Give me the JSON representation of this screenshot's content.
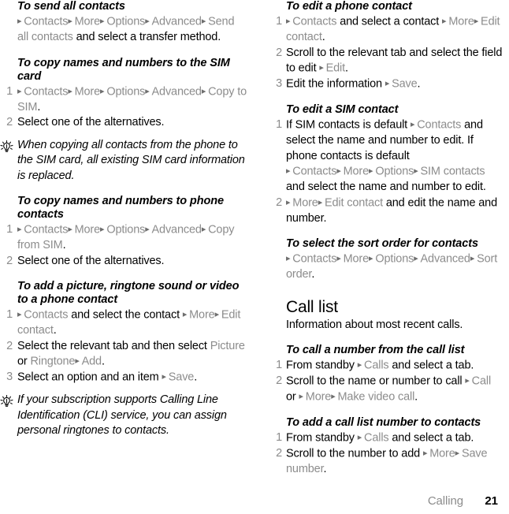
{
  "footer": {
    "chapter": "Calling",
    "page_number": "21"
  },
  "icons": {
    "tip": "lightbulb-icon",
    "arrow": "▸"
  },
  "left_column": [
    {
      "type": "procedure",
      "name": "send-all-contacts",
      "heading": "To send all contacts",
      "steps": [
        {
          "num": "",
          "parts": [
            {
              "t": "arrow"
            },
            {
              "t": "ui",
              "v": "Contacts"
            },
            {
              "t": "arrow"
            },
            {
              "t": "ui",
              "v": "More"
            },
            {
              "t": "arrow"
            },
            {
              "t": "ui",
              "v": "Options"
            },
            {
              "t": "arrow"
            },
            {
              "t": "ui",
              "v": "Advanced"
            },
            {
              "t": "arrow"
            },
            {
              "t": "ui",
              "v": "Send all contacts"
            },
            {
              "t": "txt",
              "v": " and select a transfer method."
            }
          ]
        }
      ]
    },
    {
      "type": "procedure",
      "name": "copy-names-numbers-to-sim",
      "heading": "To copy names and numbers to the SIM card",
      "steps": [
        {
          "num": "1",
          "parts": [
            {
              "t": "arrow"
            },
            {
              "t": "ui",
              "v": "Contacts"
            },
            {
              "t": "arrow"
            },
            {
              "t": "ui",
              "v": "More"
            },
            {
              "t": "arrow"
            },
            {
              "t": "ui",
              "v": "Options"
            },
            {
              "t": "arrow"
            },
            {
              "t": "ui",
              "v": "Advanced"
            },
            {
              "t": "arrow"
            },
            {
              "t": "ui",
              "v": "Copy to SIM"
            },
            {
              "t": "txt",
              "v": "."
            }
          ]
        },
        {
          "num": "2",
          "parts": [
            {
              "t": "txt",
              "v": "Select one of the alternatives."
            }
          ]
        }
      ]
    },
    {
      "type": "tip",
      "name": "tip-copy-replaces-sim",
      "text": "When copying all contacts from the phone to the SIM card, all existing SIM card information is replaced."
    },
    {
      "type": "procedure",
      "name": "copy-names-numbers-to-phone",
      "heading": "To copy names and numbers to phone contacts",
      "steps": [
        {
          "num": "1",
          "parts": [
            {
              "t": "arrow"
            },
            {
              "t": "ui",
              "v": "Contacts"
            },
            {
              "t": "arrow"
            },
            {
              "t": "ui",
              "v": "More"
            },
            {
              "t": "arrow"
            },
            {
              "t": "ui",
              "v": "Options"
            },
            {
              "t": "arrow"
            },
            {
              "t": "ui",
              "v": "Advanced"
            },
            {
              "t": "arrow"
            },
            {
              "t": "ui",
              "v": "Copy from SIM"
            },
            {
              "t": "txt",
              "v": "."
            }
          ]
        },
        {
          "num": "2",
          "parts": [
            {
              "t": "txt",
              "v": "Select one of the alternatives."
            }
          ]
        }
      ]
    },
    {
      "type": "procedure",
      "name": "add-picture-ringtone-video",
      "heading": "To add a picture, ringtone sound or video to a phone contact",
      "steps": [
        {
          "num": "1",
          "parts": [
            {
              "t": "arrow"
            },
            {
              "t": "ui",
              "v": "Contacts"
            },
            {
              "t": "txt",
              "v": " and select the contact "
            },
            {
              "t": "arrow"
            },
            {
              "t": "ui",
              "v": "More"
            },
            {
              "t": "arrow"
            },
            {
              "t": "ui",
              "v": "Edit contact"
            },
            {
              "t": "txt",
              "v": "."
            }
          ]
        },
        {
          "num": "2",
          "parts": [
            {
              "t": "txt",
              "v": "Select the relevant tab and then select "
            },
            {
              "t": "ui",
              "v": "Picture"
            },
            {
              "t": "txt",
              "v": " or "
            },
            {
              "t": "ui",
              "v": "Ringtone"
            },
            {
              "t": "arrow"
            },
            {
              "t": "ui",
              "v": "Add"
            },
            {
              "t": "txt",
              "v": "."
            }
          ]
        },
        {
          "num": "3",
          "parts": [
            {
              "t": "txt",
              "v": "Select an option and an item "
            },
            {
              "t": "arrow"
            },
            {
              "t": "ui",
              "v": "Save"
            },
            {
              "t": "txt",
              "v": "."
            }
          ]
        }
      ]
    },
    {
      "type": "tip",
      "name": "tip-cli-personal-ringtones",
      "text": "If your subscription supports Calling Line Identification (CLI) service, you can assign personal ringtones to contacts."
    }
  ],
  "right_column": [
    {
      "type": "procedure",
      "name": "edit-phone-contact",
      "heading": "To edit a phone contact",
      "steps": [
        {
          "num": "1",
          "parts": [
            {
              "t": "arrow"
            },
            {
              "t": "ui",
              "v": "Contacts"
            },
            {
              "t": "txt",
              "v": " and select a contact "
            },
            {
              "t": "arrow"
            },
            {
              "t": "ui",
              "v": "More"
            },
            {
              "t": "arrow"
            },
            {
              "t": "ui",
              "v": "Edit contact"
            },
            {
              "t": "txt",
              "v": "."
            }
          ]
        },
        {
          "num": "2",
          "parts": [
            {
              "t": "txt",
              "v": "Scroll to the relevant tab and select the field to edit "
            },
            {
              "t": "arrow"
            },
            {
              "t": "ui",
              "v": "Edit"
            },
            {
              "t": "txt",
              "v": "."
            }
          ]
        },
        {
          "num": "3",
          "parts": [
            {
              "t": "txt",
              "v": "Edit the information "
            },
            {
              "t": "arrow"
            },
            {
              "t": "ui",
              "v": "Save"
            },
            {
              "t": "txt",
              "v": "."
            }
          ]
        }
      ]
    },
    {
      "type": "procedure",
      "name": "edit-sim-contact",
      "heading": "To edit a SIM contact",
      "steps": [
        {
          "num": "1",
          "parts": [
            {
              "t": "txt",
              "v": "If SIM contacts is default "
            },
            {
              "t": "arrow"
            },
            {
              "t": "ui",
              "v": "Contacts"
            },
            {
              "t": "txt",
              "v": " and select the name and number to edit. If phone contacts is default "
            },
            {
              "t": "arrow"
            },
            {
              "t": "ui",
              "v": "Contacts"
            },
            {
              "t": "arrow"
            },
            {
              "t": "ui",
              "v": "More"
            },
            {
              "t": "arrow"
            },
            {
              "t": "ui",
              "v": "Options"
            },
            {
              "t": "arrow"
            },
            {
              "t": "ui",
              "v": "SIM contacts"
            },
            {
              "t": "txt",
              "v": " and select the name and number to edit."
            }
          ]
        },
        {
          "num": "2",
          "parts": [
            {
              "t": "arrow"
            },
            {
              "t": "ui",
              "v": "More"
            },
            {
              "t": "arrow"
            },
            {
              "t": "ui",
              "v": "Edit contact"
            },
            {
              "t": "txt",
              "v": " and edit the name and number."
            }
          ]
        }
      ]
    },
    {
      "type": "procedure",
      "name": "select-sort-order",
      "heading": "To select the sort order for contacts",
      "steps": [
        {
          "num": "",
          "parts": [
            {
              "t": "arrow"
            },
            {
              "t": "ui",
              "v": "Contacts"
            },
            {
              "t": "arrow"
            },
            {
              "t": "ui",
              "v": "More"
            },
            {
              "t": "arrow"
            },
            {
              "t": "ui",
              "v": "Options"
            },
            {
              "t": "arrow"
            },
            {
              "t": "ui",
              "v": "Advanced"
            },
            {
              "t": "arrow"
            },
            {
              "t": "ui",
              "v": "Sort order"
            },
            {
              "t": "txt",
              "v": "."
            }
          ]
        }
      ]
    },
    {
      "type": "section",
      "name": "call-list",
      "heading": "Call list",
      "body": "Information about most recent calls."
    },
    {
      "type": "procedure",
      "name": "call-number-from-call-list",
      "heading": "To call a number from the call list",
      "steps": [
        {
          "num": "1",
          "parts": [
            {
              "t": "txt",
              "v": "From standby "
            },
            {
              "t": "arrow"
            },
            {
              "t": "ui",
              "v": "Calls"
            },
            {
              "t": "txt",
              "v": " and select a tab."
            }
          ]
        },
        {
          "num": "2",
          "parts": [
            {
              "t": "txt",
              "v": "Scroll to the name or number to call "
            },
            {
              "t": "arrow"
            },
            {
              "t": "ui",
              "v": "Call"
            },
            {
              "t": "txt",
              "v": " or "
            },
            {
              "t": "arrow"
            },
            {
              "t": "ui",
              "v": "More"
            },
            {
              "t": "arrow"
            },
            {
              "t": "ui",
              "v": "Make video call"
            },
            {
              "t": "txt",
              "v": "."
            }
          ]
        }
      ]
    },
    {
      "type": "procedure",
      "name": "add-call-list-number-to-contacts",
      "heading": "To add a call list number to contacts",
      "steps": [
        {
          "num": "1",
          "parts": [
            {
              "t": "txt",
              "v": "From standby "
            },
            {
              "t": "arrow"
            },
            {
              "t": "ui",
              "v": "Calls"
            },
            {
              "t": "txt",
              "v": " and select a tab."
            }
          ]
        },
        {
          "num": "2",
          "parts": [
            {
              "t": "txt",
              "v": "Scroll to the number to add "
            },
            {
              "t": "arrow"
            },
            {
              "t": "ui",
              "v": "More"
            },
            {
              "t": "arrow"
            },
            {
              "t": "ui",
              "v": "Save number"
            },
            {
              "t": "txt",
              "v": "."
            }
          ]
        }
      ]
    }
  ]
}
